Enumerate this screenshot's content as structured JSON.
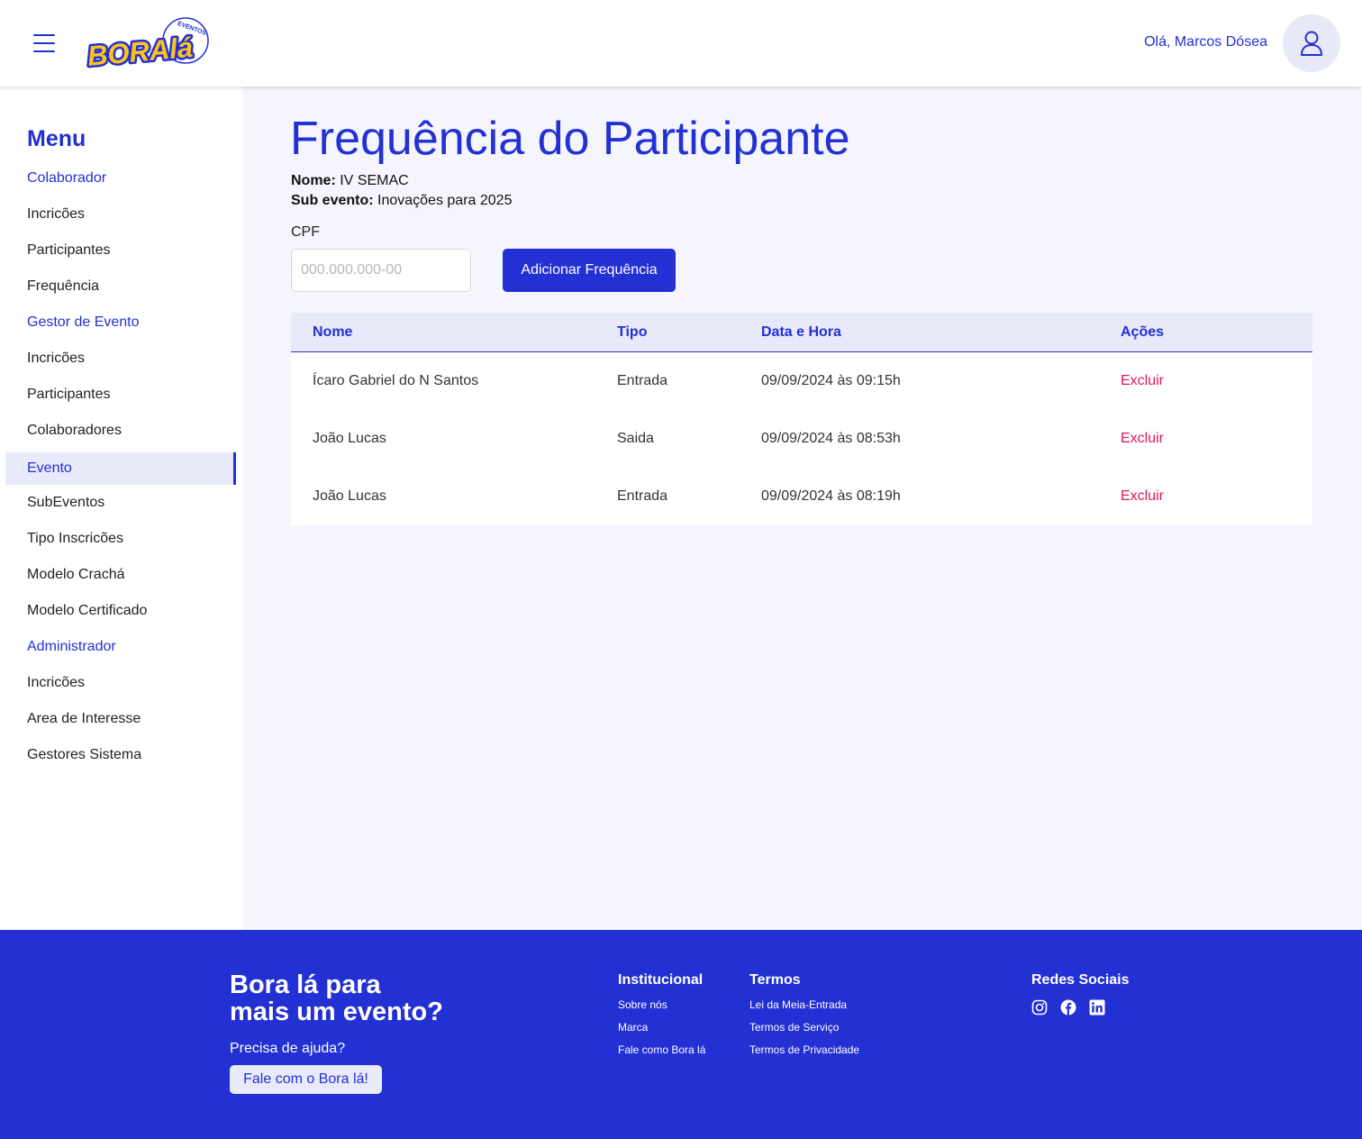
{
  "header": {
    "logo_text": "BORAlá",
    "logo_sub": "EVENTOS",
    "greeting": "Olá, Marcos Dósea"
  },
  "sidebar": {
    "title": "Menu",
    "items": [
      {
        "label": "Colaborador",
        "kind": "section"
      },
      {
        "label": "Incricões",
        "kind": "item"
      },
      {
        "label": "Participantes",
        "kind": "item"
      },
      {
        "label": "Frequência",
        "kind": "item"
      },
      {
        "label": "Gestor de Evento",
        "kind": "section"
      },
      {
        "label": "Incricões",
        "kind": "item"
      },
      {
        "label": "Participantes",
        "kind": "item"
      },
      {
        "label": "Colaboradores",
        "kind": "item"
      },
      {
        "label": "Evento",
        "kind": "active"
      },
      {
        "label": "SubEventos",
        "kind": "item"
      },
      {
        "label": "Tipo Inscricões",
        "kind": "item"
      },
      {
        "label": "Modelo Crachá",
        "kind": "item"
      },
      {
        "label": "Modelo Certificado",
        "kind": "item"
      },
      {
        "label": "Administrador",
        "kind": "section"
      },
      {
        "label": "Incricões",
        "kind": "item"
      },
      {
        "label": "Area de Interesse",
        "kind": "item"
      },
      {
        "label": "Gestores Sistema",
        "kind": "item"
      }
    ]
  },
  "main": {
    "title": "Frequência do Participante",
    "nome_label": "Nome:",
    "nome_value": "IV SEMAC",
    "sub_label": "Sub evento:",
    "sub_value": "Inovações para 2025",
    "cpf_label": "CPF",
    "cpf_placeholder": "000.000.000-00",
    "add_button": "Adicionar Frequência",
    "table": {
      "headers": [
        "Nome",
        "Tipo",
        "Data e Hora",
        "Ações"
      ],
      "rows": [
        {
          "nome": "Ícaro Gabriel do N Santos",
          "tipo": "Entrada",
          "data": "09/09/2024 às 09:15h",
          "acao": "Excluir"
        },
        {
          "nome": "João Lucas",
          "tipo": "Saida",
          "data": "09/09/2024 às 08:53h",
          "acao": "Excluir"
        },
        {
          "nome": "João Lucas",
          "tipo": "Entrada",
          "data": "09/09/2024 às 08:19h",
          "acao": "Excluir"
        }
      ]
    }
  },
  "footer": {
    "headline_1": "Bora lá para",
    "headline_2": "mais um evento?",
    "help": "Precisa de ajuda?",
    "help_button": "Fale com o Bora lá!",
    "institucional": {
      "title": "Institucional",
      "links": [
        "Sobre nós",
        "Marca",
        "Fale como Bora lá"
      ]
    },
    "termos": {
      "title": "Termos",
      "links": [
        "Lei da Meia-Entrada",
        "Termos de Serviço",
        "Termos de Privacidade"
      ]
    },
    "social": {
      "title": "Redes Sociais",
      "icons": [
        "instagram-icon",
        "facebook-icon",
        "linkedin-icon"
      ]
    }
  },
  "colors": {
    "primary": "#2230d4",
    "danger": "#e0155f",
    "background": "#f5f6fd"
  }
}
